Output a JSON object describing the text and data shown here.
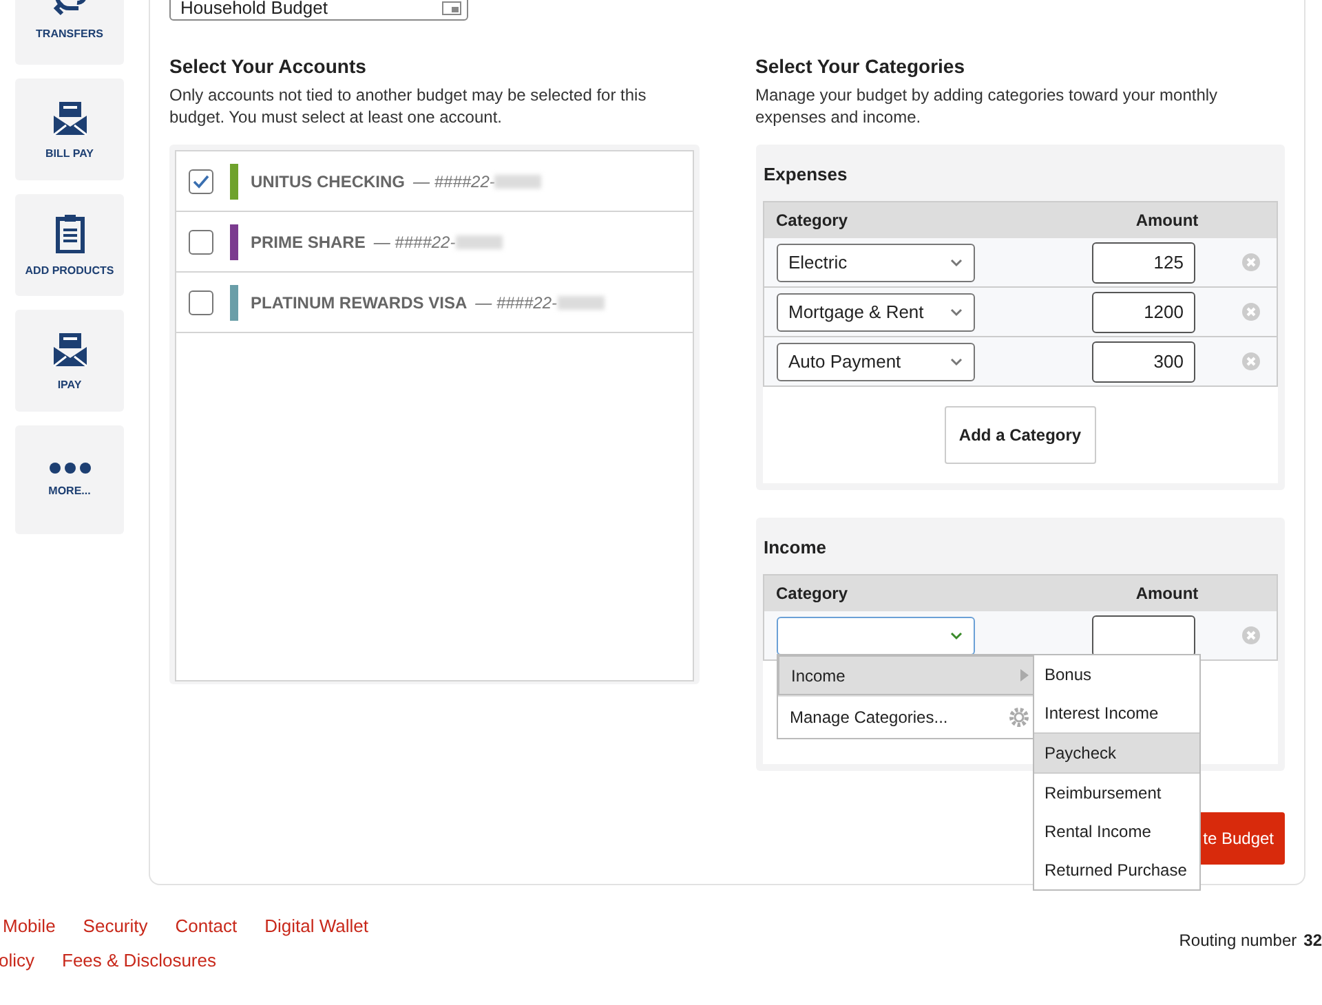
{
  "sidebar": {
    "items": [
      {
        "label": "TRANSFERS",
        "kind": "transfer"
      },
      {
        "label": "BILL PAY",
        "kind": "envelope"
      },
      {
        "label": "ADD PRODUCTS",
        "kind": "clipboard"
      },
      {
        "label": "IPAY",
        "kind": "envelope"
      },
      {
        "label": "MORE...",
        "kind": "more"
      }
    ]
  },
  "budget_name": {
    "value": "Household Budget"
  },
  "accounts": {
    "title": "Select Your Accounts",
    "description": "Only accounts not tied to another budget may be selected for this budget. You must select at least one account.",
    "items": [
      {
        "name": "UNITUS CHECKING",
        "number": "— ####22-",
        "checked": true,
        "color": "#6fa22c"
      },
      {
        "name": "PRIME SHARE",
        "number": "— ####22-",
        "checked": false,
        "color": "#7b3b8f"
      },
      {
        "name": "PLATINUM REWARDS VISA",
        "number": "— ####22-",
        "checked": false,
        "color": "#6a9ea8"
      }
    ]
  },
  "categories": {
    "title": "Select Your Categories",
    "description": "Manage your budget by adding categories toward your monthly expenses and income.",
    "expenses": {
      "title": "Expenses",
      "columns": [
        "Category",
        "Amount"
      ],
      "rows": [
        {
          "category": "Electric",
          "amount": "125",
          "focused": false
        },
        {
          "category": "Mortgage & Rent",
          "amount": "1200",
          "focused": false
        },
        {
          "category": "Auto Payment",
          "amount": "300",
          "focused": false
        }
      ],
      "add_button": "Add a Category"
    },
    "income": {
      "title": "Income",
      "columns": [
        "Category",
        "Amount"
      ],
      "rows": [
        {
          "focused": true
        }
      ],
      "dropdown": {
        "items": [
          {
            "label": "Income",
            "kind": "submenu",
            "selected": true
          },
          {
            "label": "Manage Categories...",
            "kind": "action",
            "selected": false
          }
        ],
        "submenu": [
          {
            "label": "Bonus",
            "selected": false
          },
          {
            "label": "Interest Income",
            "selected": false
          },
          {
            "label": "Paycheck",
            "selected": true
          },
          {
            "label": "Reimbursement",
            "selected": false
          },
          {
            "label": "Rental Income",
            "selected": false
          },
          {
            "label": "Returned Purchase",
            "selected": false
          }
        ]
      }
    }
  },
  "create_button": "te Budget",
  "footer": {
    "link_rows": [
      [
        "Mobile",
        "Security",
        "Contact",
        "Digital Wallet"
      ],
      [
        "olicy",
        "Fees & Disclosures"
      ]
    ],
    "routing_label": "Routing number",
    "routing_number": "32"
  }
}
